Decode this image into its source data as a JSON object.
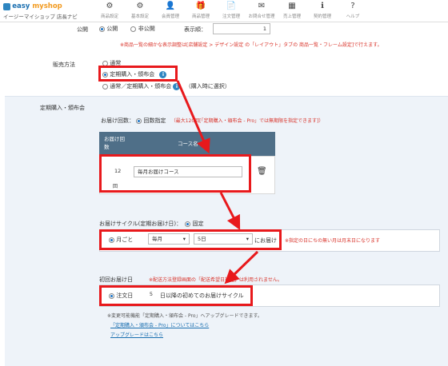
{
  "brand": {
    "name_prefix": "easy",
    "name_suffix": "myshop",
    "subtitle": "イージーマイショップ 店長ナビ"
  },
  "nav": [
    {
      "label": "商品設定",
      "icon": "gear-icon"
    },
    {
      "label": "基本設定",
      "icon": "gear-icon"
    },
    {
      "label": "会員管理",
      "icon": "user-icon"
    },
    {
      "label": "商品管理",
      "icon": "gift-icon"
    },
    {
      "label": "注文管理",
      "icon": "document-icon"
    },
    {
      "label": "お問合せ管理",
      "icon": "mail-icon"
    },
    {
      "label": "売上管理",
      "icon": "grid-icon"
    },
    {
      "label": "契約管理",
      "icon": "info-icon"
    },
    {
      "label": "ヘルプ",
      "icon": "question-icon"
    }
  ],
  "publish": {
    "label": "公開",
    "option_public": "公開",
    "option_private": "非公開",
    "order_label": "表示順：",
    "order_value": "1",
    "note": "※商品一覧の細かな表示調整は[店舗設定 > デザイン設定 の「レイアウト」タブの 商品一覧・フレーム設定]で行えます。"
  },
  "sales_method": {
    "label": "販売方法",
    "option_normal": "通常",
    "option_subscription": "定期購入・頒布会",
    "option_both": "通常／定期購入・頒布会",
    "option_both_note": "（購入時に選択）"
  },
  "subscription": {
    "label": "定期購入・頒布会",
    "count_label": "お届け回数：",
    "count_option": "回数指定",
    "count_note": "（最大120回[「定期購入・頒布会 - Pro」では無期限を指定できます]）",
    "col_count": "お届け回数",
    "col_course": "コース名",
    "row_count": "12",
    "row_unit": "回",
    "row_course": "毎月お届けコース",
    "delete_icon": "trash-icon"
  },
  "cycle": {
    "label": "お届けサイクル(定期お届け日)：",
    "mode": "固定",
    "option": "月ごと",
    "month_select": "毎月",
    "day_select": "5日",
    "suffix": "にお届け",
    "note": "※指定の日にちの無い月は月末日になります"
  },
  "first_delivery": {
    "label": "初回お届け日",
    "note": "※配送方法登録画面の「配送希望日指定」は利用されません。",
    "option": "注文日",
    "days": "5",
    "suffix": "日以降の初めてのお届けサイクル",
    "upgrade_note": "※変更可能機能「定期購入・頒布会 - Pro」へアップグレードできます。",
    "link1": "「定期購入・頒布会 - Pro」についてはこちら",
    "link2": "アップグレードはこちら"
  },
  "colors": {
    "highlight": "#e8191c",
    "accent": "#1a6fb0",
    "table_header": "#4f6f88"
  }
}
